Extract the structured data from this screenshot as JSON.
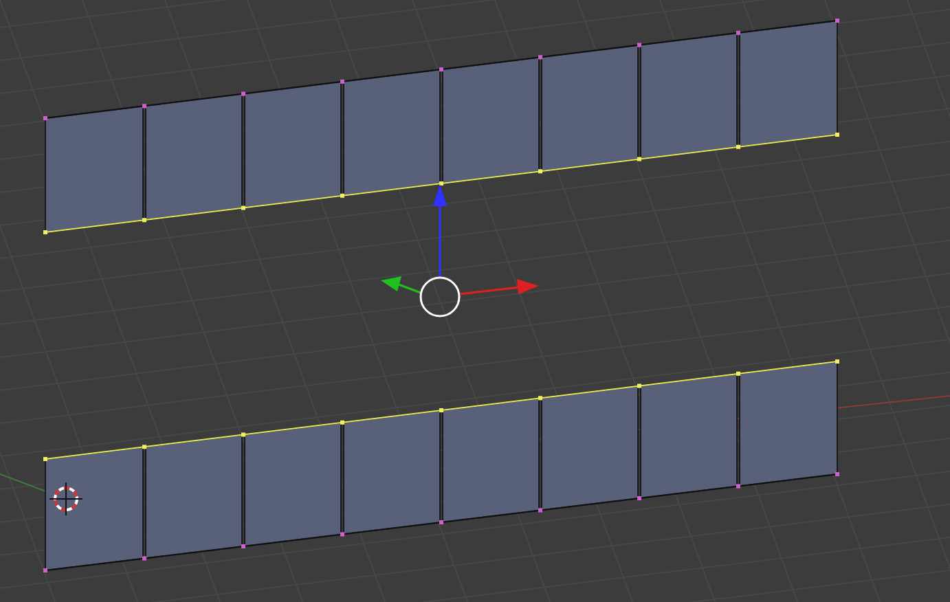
{
  "meshes": [
    {
      "top_edge_selected": false,
      "bottom_edge_selected": true
    },
    {
      "top_edge_selected": true,
      "bottom_edge_selected": false
    }
  ]
}
